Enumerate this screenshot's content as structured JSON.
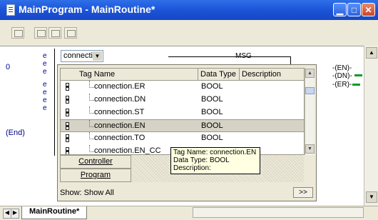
{
  "window": {
    "title": "MainProgram - MainRoutine*",
    "buttons": {
      "minimize": "▁",
      "maximize": "□",
      "close": "✕"
    }
  },
  "ladder": {
    "rung_number": "0",
    "end_label": "(End)",
    "rung_marks": [
      "e",
      "e",
      "e",
      "e",
      "e",
      "e",
      "e"
    ],
    "tag_combo_value": "connectio",
    "instruction": "MSG",
    "outputs": [
      "EN",
      "DN",
      "ER"
    ]
  },
  "tag_browser": {
    "columns": [
      "Tag Name",
      "Data Type",
      "Description"
    ],
    "rows": [
      {
        "name": "connection.ER",
        "type": "BOOL",
        "selected": false
      },
      {
        "name": "connection.DN",
        "type": "BOOL",
        "selected": false
      },
      {
        "name": "connection.ST",
        "type": "BOOL",
        "selected": false
      },
      {
        "name": "connection.EN",
        "type": "BOOL",
        "selected": true
      },
      {
        "name": "connection.TO",
        "type": "BOOL",
        "selected": false
      },
      {
        "name": "connection.EN_CC",
        "type": "",
        "selected": false
      }
    ],
    "scope_buttons": [
      "Controller",
      "Program"
    ],
    "show_label": "Show: Show All",
    "more_button": ">>"
  },
  "tooltip": {
    "line1": "Tag Name: connection.EN",
    "line2": "Data Type: BOOL",
    "line3": "Description:"
  },
  "tabs": {
    "active": "MainRoutine*"
  },
  "colors": {
    "title_bar": "#1a52d6",
    "accent_green": "#0a9a2a",
    "tooltip_bg": "#ffffe1"
  }
}
